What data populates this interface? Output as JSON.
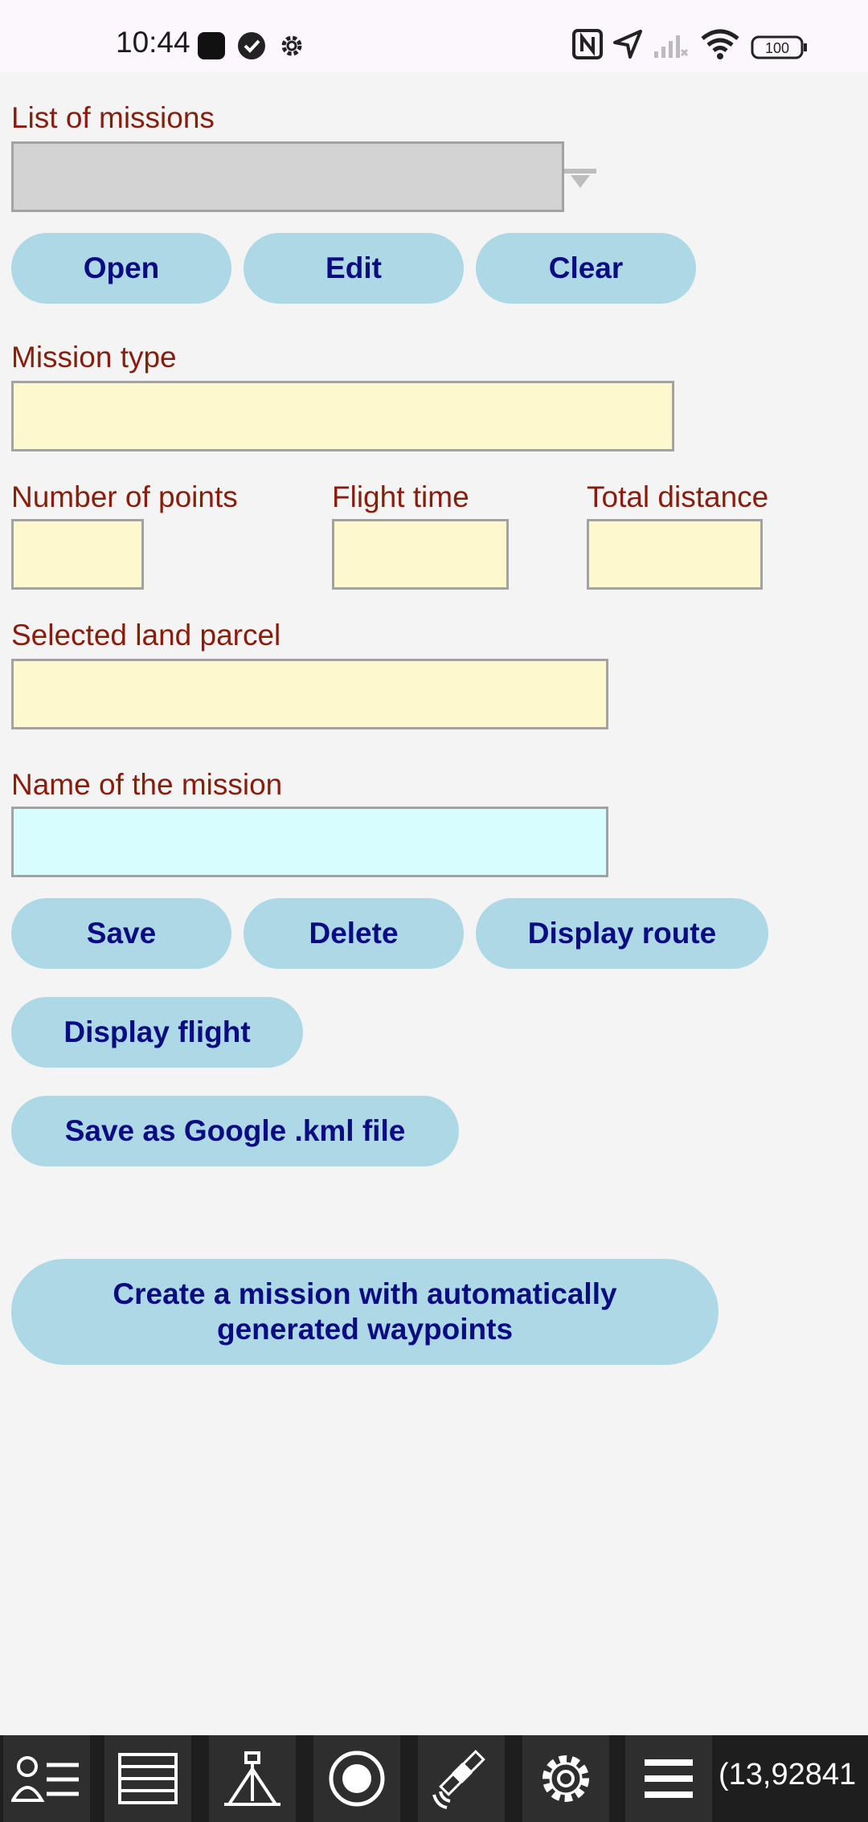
{
  "status_bar": {
    "time": "10:44",
    "battery": "100"
  },
  "form": {
    "list_label": "List of missions",
    "list_value": "",
    "buttons_row1": {
      "open": "Open",
      "edit": "Edit",
      "clear": "Clear"
    },
    "mission_type_label": "Mission type",
    "mission_type_value": "",
    "points_label": "Number of points",
    "points_value": "",
    "flight_time_label": "Flight time",
    "flight_time_value": "",
    "distance_label": "Total distance",
    "distance_value": "",
    "parcel_label": "Selected land parcel",
    "parcel_value": "",
    "name_label": "Name of the mission",
    "name_value": "",
    "buttons_row2": {
      "save": "Save",
      "delete": "Delete",
      "display_route": "Display route"
    },
    "display_flight": "Display flight",
    "save_kml": "Save as Google .kml file",
    "create_auto": "Create a mission with automatically generated waypoints"
  },
  "bottom_bar": {
    "icons": [
      "contacts-list-icon",
      "layers-icon",
      "survey-tripod-icon",
      "record-icon",
      "satellite-icon",
      "gear-icon",
      "menu-icon"
    ],
    "coordinate": "(13,92841"
  }
}
